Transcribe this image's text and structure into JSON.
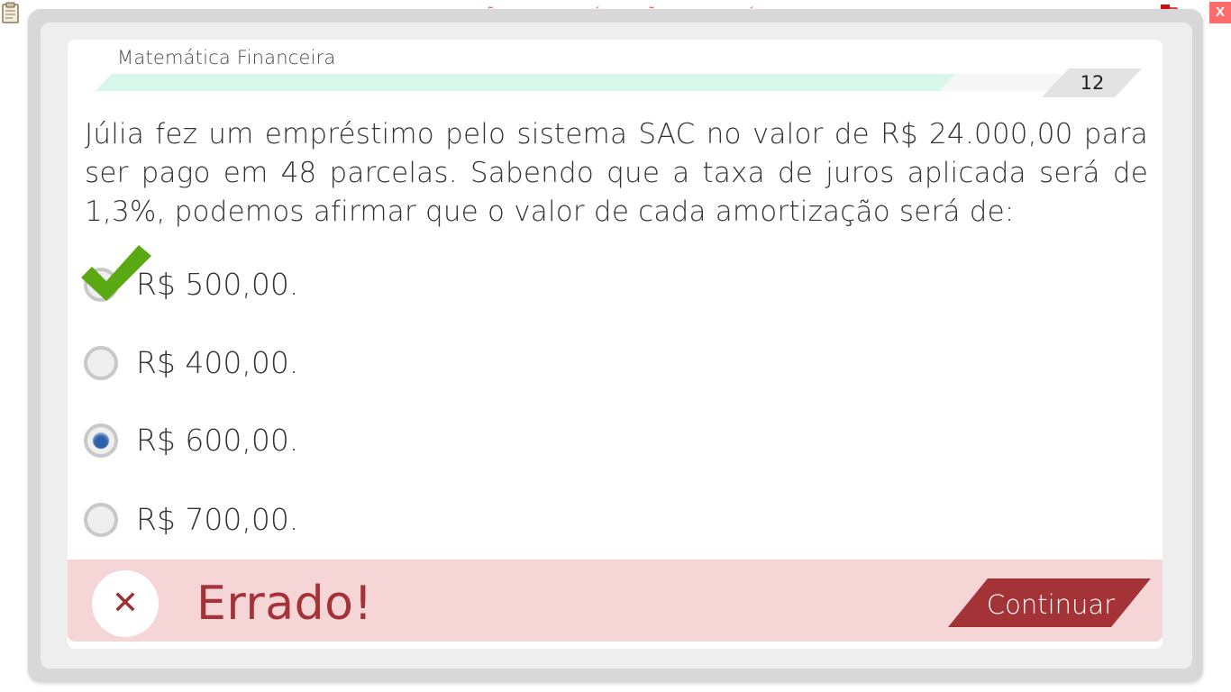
{
  "topbar": {
    "title": "VERSÃO PARA FUNCIONÁRIOS - NÃO COMERCIALIZÁVEL",
    "close_label": "X"
  },
  "lesson": {
    "subject": "Matemática Financeira",
    "progress": 0.88,
    "question_number": "12"
  },
  "question": {
    "text": "Júlia fez um empréstimo pelo sistema SAC no valor de R$ 24.000,00 para ser pago em 48 parcelas. Sabendo que a taxa de juros aplicada será de 1,3%, podemos afirmar que o valor de cada amortização será de:"
  },
  "options": [
    {
      "label": "R$ 500,00.",
      "selected": false,
      "correct": true
    },
    {
      "label": "R$ 400,00.",
      "selected": false,
      "correct": false
    },
    {
      "label": "R$ 600,00.",
      "selected": true,
      "correct": false
    },
    {
      "label": "R$ 700,00.",
      "selected": false,
      "correct": false
    }
  ],
  "feedback": {
    "icon": "x-icon",
    "title": "Errado!",
    "continue_label": "Continuar"
  },
  "colors": {
    "accent_red": "#a33336",
    "feedback_bg": "#f5d5d6",
    "progress_fill": "#d6f7ea",
    "radio_selected": "#2d5fa8",
    "check_green": "#5aa913"
  }
}
